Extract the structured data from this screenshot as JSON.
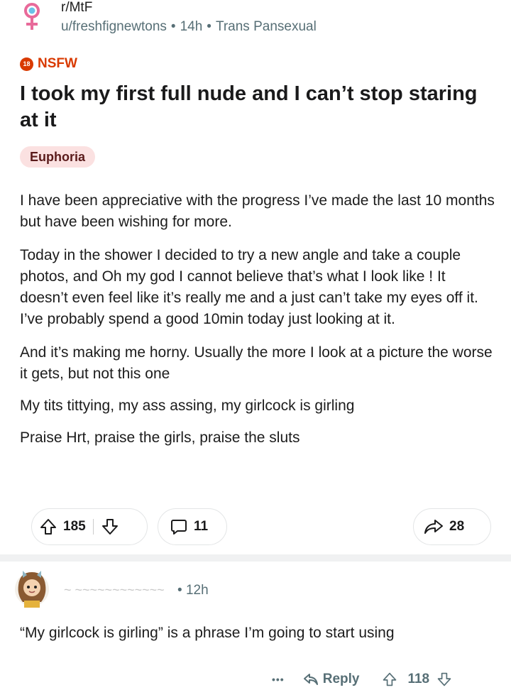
{
  "header": {
    "subreddit": "r/MtF",
    "author": "u/freshfignewtons",
    "age": "14h",
    "user_flair": "Trans Pansexual",
    "icon": "transgender-symbol-icon"
  },
  "post": {
    "nsfw_label": "NSFW",
    "nsfw_badge": "18",
    "title": "I took my first full nude and I can’t stop staring at it",
    "flair": "Euphoria",
    "paragraphs": [
      "I have been appreciative with the progress I’ve made the last 10 months but have been wishing for more.",
      "Today in the shower I decided to try a new angle and take a couple photos, and Oh my god I cannot believe that’s what I look like ! It doesn’t even feel like it’s really me and a just can’t take my eyes off it. I’ve probably spend a good 10min today just looking at it.",
      "And it’s making me horny. Usually the more I look at a picture the worse it gets, but not this one",
      "My tits tittying, my ass assing, my girlcock is girling",
      "Praise Hrt, praise the girls, praise the sluts"
    ],
    "actions": {
      "upvotes": "185",
      "comments": "11",
      "shares": "28"
    }
  },
  "comment": {
    "author": "~ ~~~~~~~~~~~~",
    "age": "12h",
    "dot": "•",
    "body": "“My girlcock is girling” is a phrase I’m going to start using",
    "more": "•••",
    "reply_label": "Reply",
    "votes": "118"
  },
  "colors": {
    "accent_nsfw": "#d93a00",
    "flair_bg": "#fbe1e1",
    "meta_gray": "#576f76"
  }
}
